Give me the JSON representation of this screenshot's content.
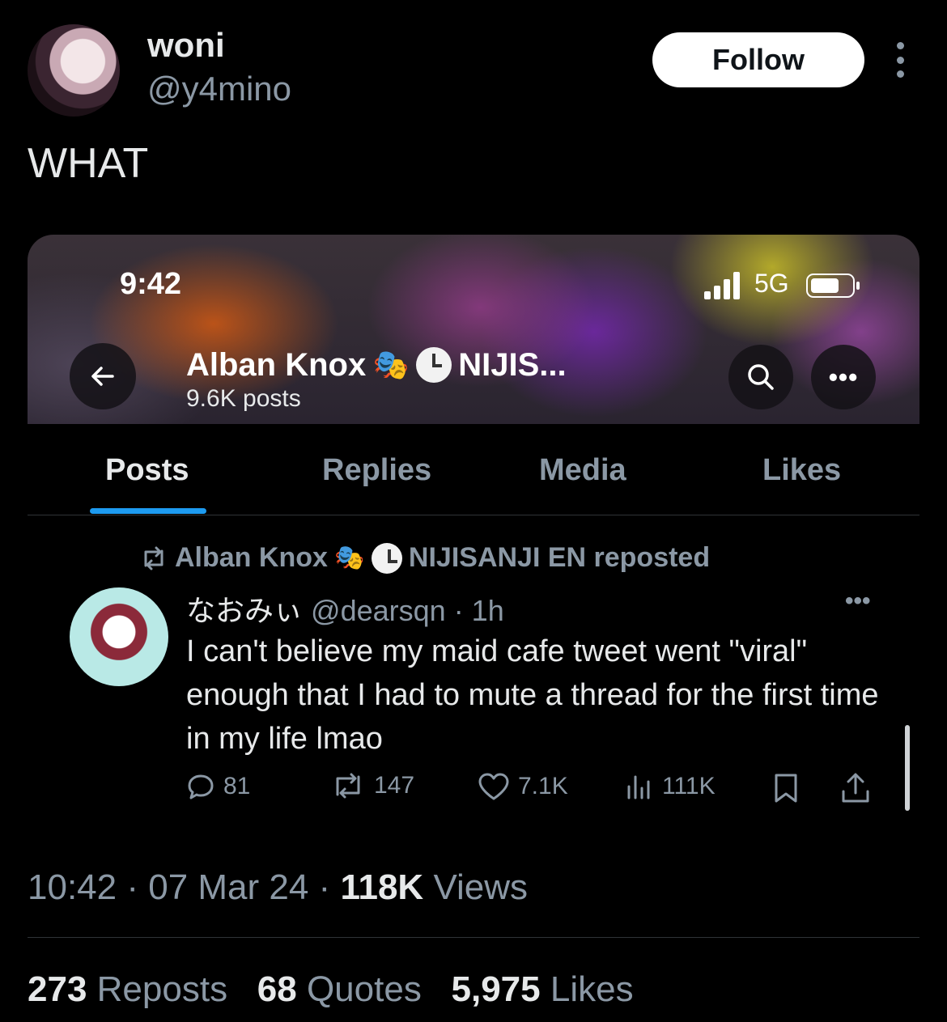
{
  "tweet": {
    "display_name": "woni",
    "handle": "@y4mino",
    "follow_label": "Follow",
    "text": "WHAT",
    "time": "10:42",
    "date": "07 Mar 24",
    "views_count": "118K",
    "views_label": "Views",
    "reposts_count": "273",
    "reposts_label": "Reposts",
    "quotes_count": "68",
    "quotes_label": "Quotes",
    "likes_count": "5,975",
    "likes_label": "Likes"
  },
  "embed": {
    "status_time": "9:42",
    "network": "5G",
    "profile_name": "Alban Knox",
    "profile_name_suffix": "NIJIS...",
    "posts_count": "9.6K posts",
    "tabs": [
      "Posts",
      "Replies",
      "Media",
      "Likes"
    ],
    "active_tab": "Posts",
    "repost_name": "Alban Knox",
    "repost_suffix": "NIJISANJI EN reposted",
    "inner_author": "なおみぃ",
    "inner_handle": "@dearsqn",
    "inner_time": "· 1h",
    "inner_text": "I can't believe my maid cafe tweet went \"viral\" enough that I had to mute a thread for the first time in my life lmao",
    "replies": "81",
    "reposts": "147",
    "likes": "7.1K",
    "views": "111K",
    "emoji": "🎭"
  },
  "colors": {
    "accent": "#1d9bf0",
    "muted": "#8b98a5",
    "text": "#e7e9ea",
    "background": "#000000"
  }
}
